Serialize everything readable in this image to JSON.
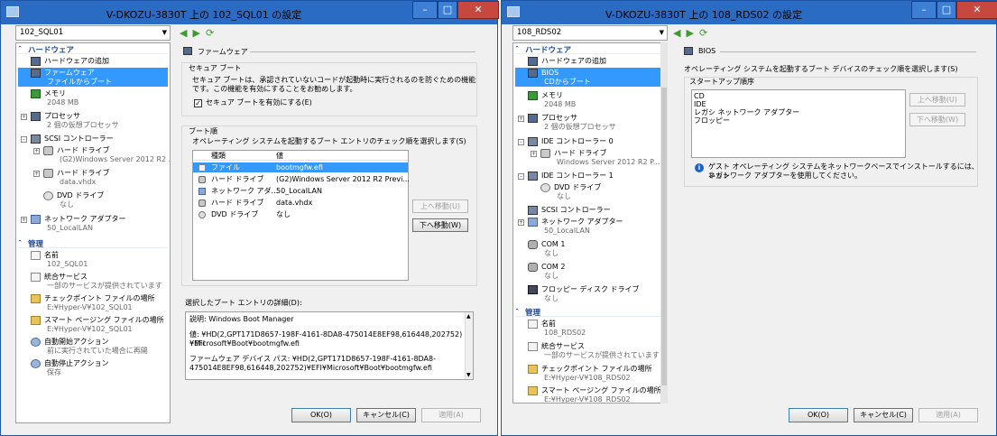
{
  "left": {
    "title": "V-DKOZU-3830T 上の 102_SQL01 の設定",
    "vm_select": "102_SQL01",
    "tree": {
      "hardware_header": "ハードウェア",
      "add_hardware": "ハードウェアの追加",
      "firmware": {
        "label": "ファームウェア",
        "sub": "ファイルからブート"
      },
      "memory": {
        "label": "メモリ",
        "sub": "2048 MB"
      },
      "processor": {
        "label": "プロセッサ",
        "sub": "2 個の仮想プロセッサ"
      },
      "scsi": {
        "label": "SCSI コントローラー"
      },
      "hdd1": {
        "label": "ハード ドライブ",
        "sub": "(G2)Windows Server 2012 R2 ..."
      },
      "hdd2": {
        "label": "ハード ドライブ",
        "sub": "data.vhdx"
      },
      "dvd": {
        "label": "DVD ドライブ",
        "sub": "なし"
      },
      "nic": {
        "label": "ネットワーク アダプター",
        "sub": "50_LocalLAN"
      },
      "mgmt_header": "管理",
      "name": {
        "label": "名前",
        "sub": "102_SQL01"
      },
      "integration": {
        "label": "統合サービス",
        "sub": "一部のサービスが提供されています"
      },
      "checkpoint": {
        "label": "チェックポイント ファイルの場所",
        "sub": "E:¥Hyper-V¥102_SQL01"
      },
      "paging": {
        "label": "スマート ページング ファイルの場所",
        "sub": "E:¥Hyper-V¥102_SQL01"
      },
      "autostart": {
        "label": "自動開始アクション",
        "sub": "前に実行されていた場合に再開"
      },
      "autostop": {
        "label": "自動停止アクション",
        "sub": "保存"
      }
    },
    "panel": {
      "heading": "ファームウェア",
      "secureboot": {
        "group": "セキュア ブート",
        "desc1": "セキュア ブートは、承認されていないコードが起動時に実行されるのを防ぐための機能",
        "desc2": "です。この機能を有効にすることをお勧めします。",
        "checkbox": "セキュア ブートを有効にする(E)",
        "checked": true
      },
      "bootorder": {
        "group": "ブート順",
        "desc": "オペレーティング システムを起動するブート エントリのチェック順を選択します(S)",
        "col_type": "種類",
        "col_value": "値",
        "rows": [
          {
            "type": "ファイル",
            "value": "bootmgfw.efi"
          },
          {
            "type": "ハード ドライブ",
            "value": "(G2)Windows Server 2012 R2 Previ..."
          },
          {
            "type": "ネットワーク アダ...",
            "value": "50_LocalLAN"
          },
          {
            "type": "ハード ドライブ",
            "value": "data.vhdx"
          },
          {
            "type": "DVD ドライブ",
            "value": "なし"
          }
        ],
        "move_up": "上へ移動(U)",
        "move_down": "下へ移動(W)"
      },
      "details": {
        "label": "選択したブート エントリの詳細(D):",
        "line1": "説明: Windows Boot Manager",
        "line2": "値: ¥HD(2,GPT171D8657-198F-4161-8DA8-475014E8EF98,616448,202752)¥EFI",
        "line3": "¥Microsoft¥Boot¥bootmgfw.efi",
        "line4": "ファームウェア デバイス パス: ¥HD(2,GPT171D8657-198F-4161-8DA8-",
        "line5": "475014E8EF98,616448,202752)¥EFI¥Microsoft¥Boot¥bootmgfw.efi"
      }
    },
    "ok": "OK(O)",
    "cancel": "キャンセル(C)",
    "apply": "適用(A)"
  },
  "right": {
    "title": "V-DKOZU-3830T 上の 108_RDS02 の設定",
    "vm_select": "108_RDS02",
    "tree": {
      "hardware_header": "ハードウェア",
      "add_hardware": "ハードウェアの追加",
      "bios": {
        "label": "BIOS",
        "sub": "CDからブート"
      },
      "memory": {
        "label": "メモリ",
        "sub": "2048 MB"
      },
      "processor": {
        "label": "プロセッサ",
        "sub": "2 個の仮想プロセッサ"
      },
      "ide0": {
        "label": "IDE コントローラー 0"
      },
      "hdd": {
        "label": "ハード ドライブ",
        "sub": "Windows Server 2012 R2 P..."
      },
      "ide1": {
        "label": "IDE コントローラー 1"
      },
      "dvd": {
        "label": "DVD ドライブ",
        "sub": "なし"
      },
      "scsi": {
        "label": "SCSI コントローラー"
      },
      "nic": {
        "label": "ネットワーク アダプター",
        "sub": "50_LocalLAN"
      },
      "com1": {
        "label": "COM 1",
        "sub": "なし"
      },
      "com2": {
        "label": "COM 2",
        "sub": "なし"
      },
      "floppy": {
        "label": "フロッピー ディスク ドライブ",
        "sub": "なし"
      },
      "mgmt_header": "管理",
      "name": {
        "label": "名前",
        "sub": "108_RDS02"
      },
      "integration": {
        "label": "統合サービス",
        "sub": "一部のサービスが提供されています"
      },
      "checkpoint": {
        "label": "チェックポイント ファイルの場所",
        "sub": "E:¥Hyper-V¥108_RDS02"
      },
      "paging": {
        "label": "スマート ページング ファイルの場所",
        "sub": "E:¥Hyper-V¥108_RDS02"
      }
    },
    "panel": {
      "heading": "BIOS",
      "desc": "オペレーティング システムを起動するブート デバイスのチェック順を選択します(S)",
      "startup_group": "スタートアップ順序",
      "startup_items": [
        "CD",
        "IDE",
        "レガシ ネットワーク アダプター",
        "フロッピー"
      ],
      "move_up": "上へ移動(U)",
      "move_down": "下へ移動(W)",
      "info1": "ゲスト オペレーティング システムをネットワークベースでインストールするには、レガシ",
      "info2": "ネットワーク アダプターを使用してください。"
    },
    "ok": "OK(O)",
    "cancel": "キャンセル(C)",
    "apply": "適用(A)"
  }
}
